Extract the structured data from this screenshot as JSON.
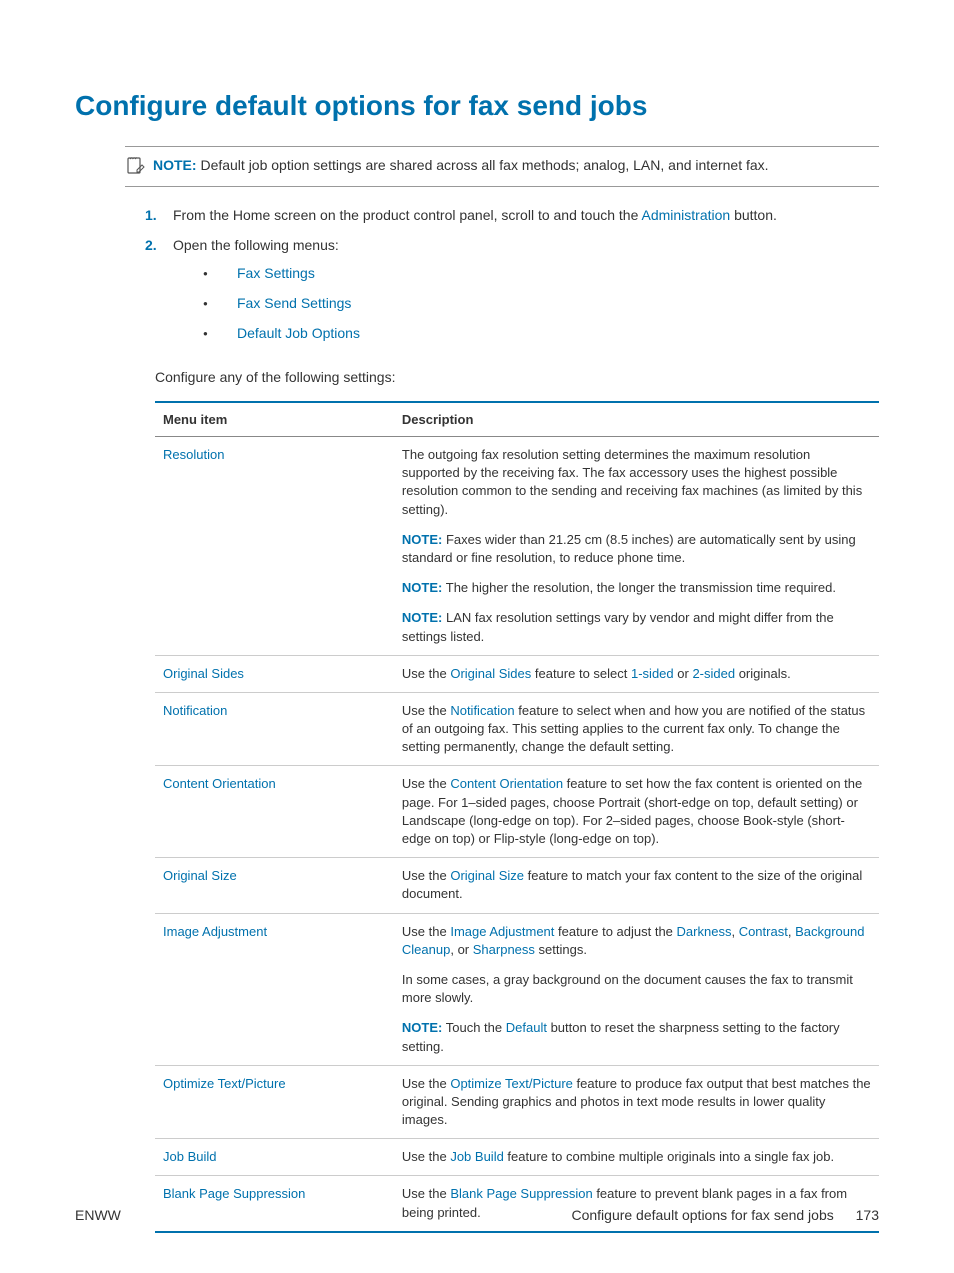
{
  "title": "Configure default options for fax send jobs",
  "topNote": {
    "label": "NOTE:",
    "text": "Default job option settings are shared across all fax methods; analog, LAN, and internet fax."
  },
  "steps": {
    "s1": {
      "num": "1.",
      "pre": "From the Home screen on the product control panel, scroll to and touch the ",
      "link": "Administration",
      "post": " button."
    },
    "s2": {
      "num": "2.",
      "text": "Open the following menus:",
      "bullets": [
        "Fax Settings",
        "Fax Send Settings",
        "Default Job Options"
      ]
    }
  },
  "intro2": "Configure any of the following settings:",
  "table": {
    "headers": [
      "Menu item",
      "Description"
    ],
    "rows": {
      "resolution": {
        "item": "Resolution",
        "p1": "The outgoing fax resolution setting determines the maximum resolution supported by the receiving fax. The fax accessory uses the highest possible resolution common to the sending and receiving fax machines (as limited by this setting).",
        "n1label": "NOTE:",
        "n1": "Faxes wider than 21.25 cm (8.5 inches) are automatically sent by using standard or fine resolution, to reduce phone time.",
        "n2label": "NOTE:",
        "n2": "The higher the resolution, the longer the transmission time required.",
        "n3label": "NOTE:",
        "n3": "LAN fax resolution settings vary by vendor and might differ from the settings listed."
      },
      "originalSides": {
        "item": "Original Sides",
        "pre": "Use the ",
        "l1": "Original Sides",
        "mid1": " feature to select ",
        "l2": "1-sided",
        "mid2": " or ",
        "l3": "2-sided",
        "post": " originals."
      },
      "notification": {
        "item": "Notification",
        "pre": "Use the ",
        "l1": "Notification",
        "post": " feature to select when and how you are notified of the status of an outgoing fax. This setting applies to the current fax only. To change the setting permanently, change the default setting."
      },
      "contentOrientation": {
        "item": "Content Orientation",
        "pre": "Use the ",
        "l1": "Content Orientation",
        "post": " feature to set how the fax content is oriented on the page. For 1–sided pages, choose Portrait (short-edge on top, default setting) or Landscape (long-edge on top). For 2–sided pages, choose Book-style (short-edge on top) or Flip-style (long-edge on top)."
      },
      "originalSize": {
        "item": "Original Size",
        "pre": "Use the ",
        "l1": "Original Size",
        "post": " feature to match your fax content to the size of the original document."
      },
      "imageAdjustment": {
        "item": "Image Adjustment",
        "pre": "Use the ",
        "l1": "Image Adjustment",
        "mid1": " feature to adjust the ",
        "l2": "Darkness",
        "c1": ", ",
        "l3": "Contrast",
        "c2": ", ",
        "l4": "Background Cleanup",
        "c3": ", or ",
        "l5": "Sharpness",
        "post": " settings.",
        "p2": "In some cases, a gray background on the document causes the fax to transmit more slowly.",
        "nlabel": "NOTE:",
        "npre": "Touch the ",
        "nl1": "Default",
        "npost": " button to reset the sharpness setting to the factory setting."
      },
      "optimize": {
        "item": "Optimize Text/Picture",
        "pre": "Use the ",
        "l1": "Optimize Text/Picture",
        "post": " feature to produce fax output that best matches the original. Sending graphics and photos in text mode results in lower quality images."
      },
      "jobBuild": {
        "item": "Job Build",
        "pre": "Use the ",
        "l1": "Job Build",
        "post": " feature to combine multiple originals into a single fax job."
      },
      "blankPage": {
        "item": "Blank Page Suppression",
        "pre": "Use the ",
        "l1": "Blank Page Suppression",
        "post": " feature to prevent blank pages in a fax from being printed."
      }
    }
  },
  "footer": {
    "left": "ENWW",
    "rightText": "Configure default options for fax send jobs",
    "page": "173"
  }
}
